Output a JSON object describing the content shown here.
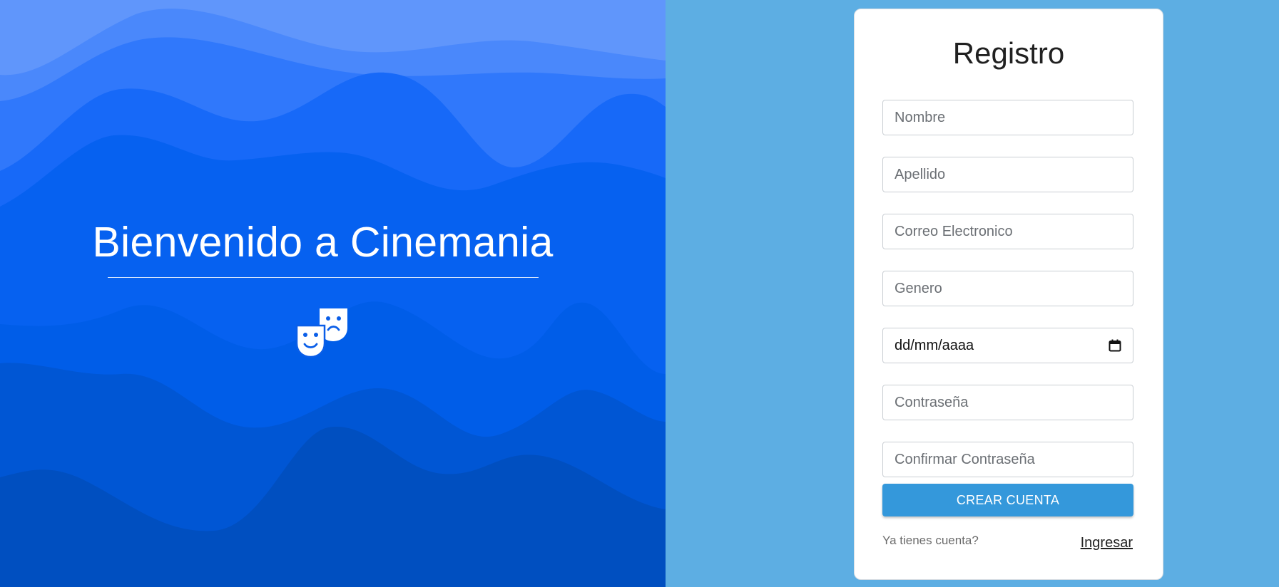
{
  "hero": {
    "title": "Bienvenido a Cinemania",
    "icon": "theater-masks-icon",
    "colors": [
      "#6096fb",
      "#4a88fb",
      "#3078fb",
      "#1769f8",
      "#0661f0",
      "#005de8",
      "#0056d4",
      "#004fc0"
    ]
  },
  "form": {
    "title": "Registro",
    "fields": {
      "nombre": {
        "placeholder": "Nombre"
      },
      "apellido": {
        "placeholder": "Apellido"
      },
      "correo": {
        "placeholder": "Correo Electronico"
      },
      "genero": {
        "placeholder": "Genero"
      },
      "fecha": {
        "value": "dd/mm/aaaa",
        "icon": "calendar-icon"
      },
      "contrasena": {
        "placeholder": "Contraseña"
      },
      "confirmar": {
        "placeholder": "Confirmar Contraseña"
      }
    },
    "submit_label": "CREAR CUENTA",
    "footer_text": "Ya tienes cuenta?",
    "login_label": "Ingresar"
  },
  "colors": {
    "side_background": "#5daee3",
    "button": "#3498db"
  }
}
